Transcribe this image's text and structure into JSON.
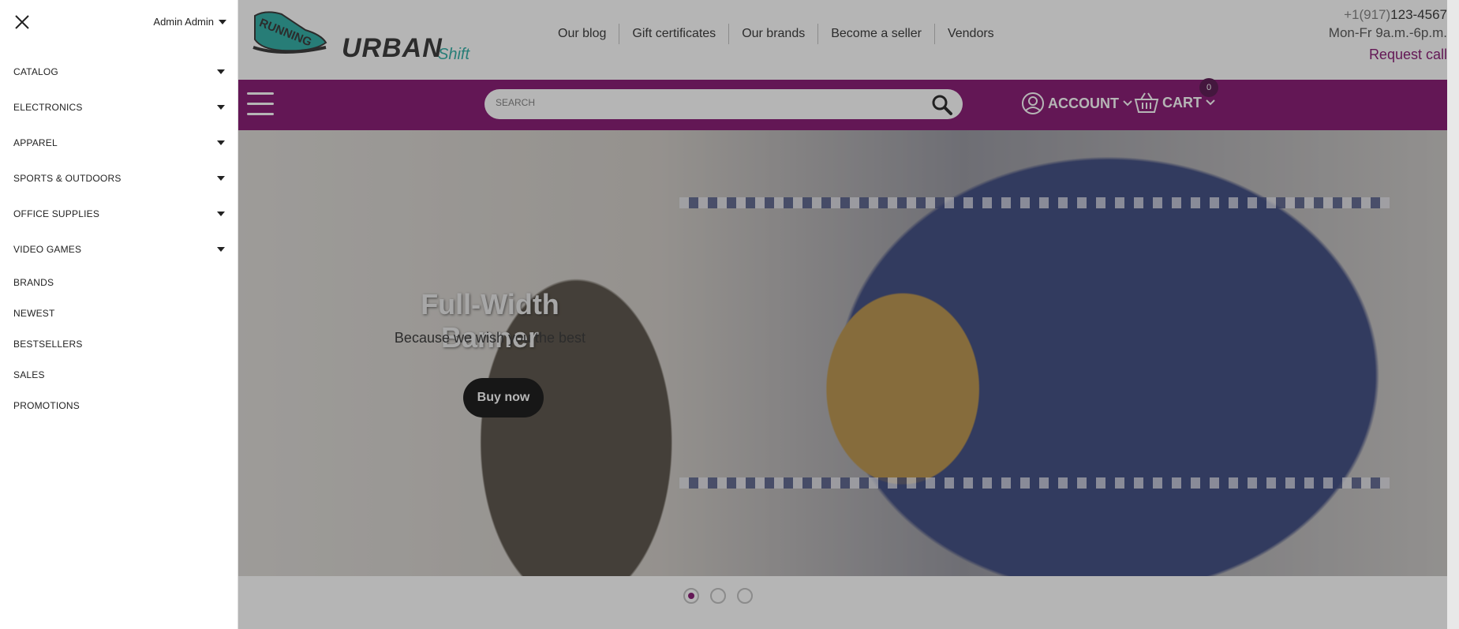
{
  "drawer": {
    "user_name": "Admin Admin",
    "menu": [
      {
        "label": "CATALOG",
        "has_submenu": true
      },
      {
        "label": "ELECTRONICS",
        "has_submenu": true
      },
      {
        "label": "APPAREL",
        "has_submenu": true
      },
      {
        "label": "SPORTS & OUTDOORS",
        "has_submenu": true
      },
      {
        "label": "OFFICE SUPPLIES",
        "has_submenu": true
      },
      {
        "label": "VIDEO GAMES",
        "has_submenu": true
      },
      {
        "label": "BRANDS",
        "has_submenu": false
      },
      {
        "label": "NEWEST",
        "has_submenu": false
      },
      {
        "label": "BESTSELLERS",
        "has_submenu": false
      },
      {
        "label": "SALES",
        "has_submenu": false
      },
      {
        "label": "PROMOTIONS",
        "has_submenu": false
      }
    ]
  },
  "header": {
    "logo_running": "RUNNING",
    "logo_urban": "URBAN",
    "logo_shift": "Shift",
    "nav": [
      "Our blog",
      "Gift certificates",
      "Our brands",
      "Become a seller",
      "Vendors"
    ],
    "phone_prefix": "+1(917)",
    "phone_number": "123-4567",
    "hours": "Mon-Fr 9a.m.-6p.m.",
    "request_call": "Request call"
  },
  "toolbar": {
    "search_placeholder": "SEARCH",
    "account_label": "ACCOUNT",
    "cart_label": "CART",
    "cart_count": "0"
  },
  "banner": {
    "title": "Full-Width Banner",
    "subtitle": "Because we wish you the best",
    "button_label": "Buy now",
    "slides_total": 3,
    "active_slide": 1
  },
  "colors": {
    "brand_purple": "#7b0064",
    "logo_teal": "#1aa59c"
  }
}
